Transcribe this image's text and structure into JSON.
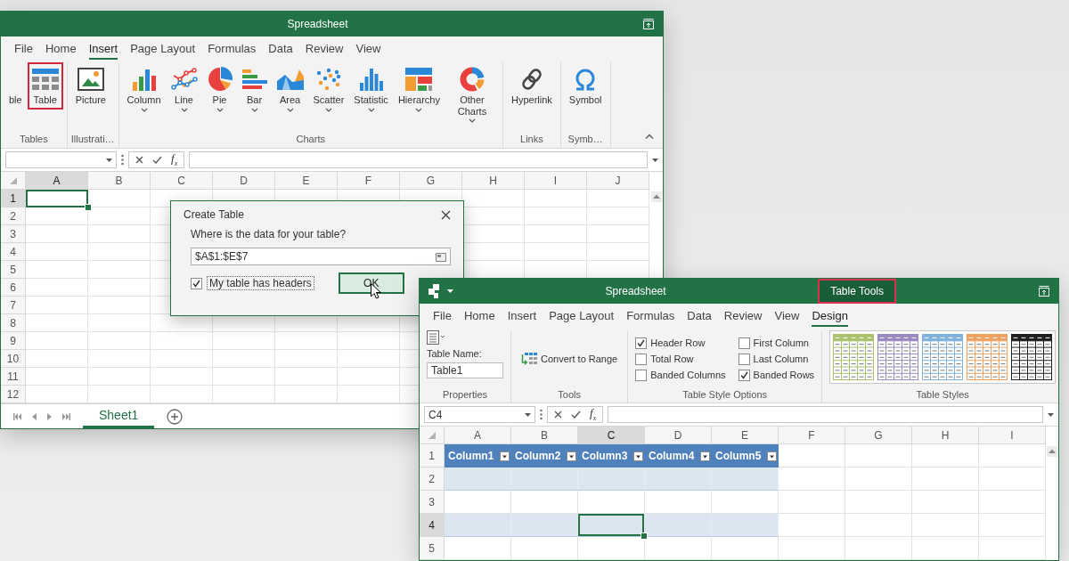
{
  "back_window": {
    "title": "Spreadsheet",
    "tabs": [
      {
        "label": "File",
        "selected": false
      },
      {
        "label": "Home",
        "selected": false
      },
      {
        "label": "Insert",
        "selected": true
      },
      {
        "label": "Page Layout",
        "selected": false
      },
      {
        "label": "Formulas",
        "selected": false
      },
      {
        "label": "Data",
        "selected": false
      },
      {
        "label": "Review",
        "selected": false
      },
      {
        "label": "View",
        "selected": false
      }
    ],
    "ribbon": {
      "groups": [
        {
          "label": "Tables",
          "buttons": [
            {
              "label": "ble",
              "kind": "pivot",
              "dropdown": false,
              "highlighted": false
            },
            {
              "label": "Table",
              "kind": "table",
              "dropdown": false,
              "highlighted": true
            }
          ]
        },
        {
          "label": "Illustrati…",
          "buttons": [
            {
              "label": "Picture",
              "kind": "picture",
              "dropdown": false,
              "highlighted": false
            }
          ]
        },
        {
          "label": "Charts",
          "buttons": [
            {
              "label": "Column",
              "kind": "column",
              "dropdown": true,
              "highlighted": false
            },
            {
              "label": "Line",
              "kind": "line",
              "dropdown": true,
              "highlighted": false
            },
            {
              "label": "Pie",
              "kind": "pie",
              "dropdown": true,
              "highlighted": false
            },
            {
              "label": "Bar",
              "kind": "bar",
              "dropdown": true,
              "highlighted": false
            },
            {
              "label": "Area",
              "kind": "area",
              "dropdown": true,
              "highlighted": false
            },
            {
              "label": "Scatter",
              "kind": "scatter",
              "dropdown": true,
              "highlighted": false
            },
            {
              "label": "Statistic",
              "kind": "statistic",
              "dropdown": true,
              "highlighted": false
            },
            {
              "label": "Hierarchy",
              "kind": "hierarchy",
              "dropdown": true,
              "highlighted": false
            },
            {
              "label": "Other Charts",
              "kind": "other",
              "dropdown": true,
              "highlighted": false
            }
          ]
        },
        {
          "label": "Links",
          "buttons": [
            {
              "label": "Hyperlink",
              "kind": "hyperlink",
              "dropdown": false,
              "highlighted": false
            }
          ]
        },
        {
          "label": "Symb…",
          "buttons": [
            {
              "label": "Symbol",
              "kind": "symbol",
              "dropdown": false,
              "highlighted": false
            }
          ]
        }
      ]
    },
    "function_button": "f$_{x}$",
    "columns": [
      {
        "label": "A",
        "selected": true
      },
      {
        "label": "B",
        "selected": false
      },
      {
        "label": "C",
        "selected": false
      },
      {
        "label": "D",
        "selected": false
      },
      {
        "label": "E",
        "selected": false
      },
      {
        "label": "F",
        "selected": false
      },
      {
        "label": "G",
        "selected": false
      },
      {
        "label": "H",
        "selected": false
      },
      {
        "label": "I",
        "selected": false
      },
      {
        "label": "J",
        "selected": false
      }
    ],
    "rows": [
      {
        "label": "1",
        "selected": true
      },
      {
        "label": "2",
        "selected": false
      },
      {
        "label": "3",
        "selected": false
      },
      {
        "label": "4",
        "selected": false
      },
      {
        "label": "5",
        "selected": false
      },
      {
        "label": "6",
        "selected": false
      },
      {
        "label": "7",
        "selected": false
      },
      {
        "label": "8",
        "selected": false
      },
      {
        "label": "9",
        "selected": false
      },
      {
        "label": "10",
        "selected": false
      },
      {
        "label": "11",
        "selected": false
      },
      {
        "label": "12",
        "selected": false
      }
    ],
    "sheet_tabs": [
      {
        "label": "Sheet1",
        "selected": true
      }
    ]
  },
  "dialog": {
    "title": "Create Table",
    "prompt": "Where is the data for your table?",
    "range": {
      "value": "$A$1:$E$7"
    },
    "headers_checkbox": {
      "label": "My table has headers",
      "checked": true
    },
    "buttons": [
      {
        "label": "OK",
        "focused": true,
        "hovered": true
      }
    ]
  },
  "front_window": {
    "title": "Spreadsheet",
    "context_tab": {
      "label": "Table Tools",
      "highlighted": true
    },
    "tabs": [
      {
        "label": "File",
        "selected": false
      },
      {
        "label": "Home",
        "selected": false
      },
      {
        "label": "Insert",
        "selected": false
      },
      {
        "label": "Page Layout",
        "selected": false
      },
      {
        "label": "Formulas",
        "selected": false
      },
      {
        "label": "Data",
        "selected": false
      },
      {
        "label": "Review",
        "selected": false
      },
      {
        "label": "View",
        "selected": false
      },
      {
        "label": "Design",
        "selected": true
      }
    ],
    "ribbon": {
      "properties": {
        "label": "Properties",
        "name_label": "Table Name:",
        "name_field": {
          "value": "Table1"
        }
      },
      "tools": {
        "label": "Tools",
        "buttons": [
          {
            "label": "Convert to Range"
          }
        ]
      },
      "style_options": {
        "label": "Table Style Options",
        "options": [
          {
            "label": "Header Row",
            "checked": true
          },
          {
            "label": "Total Row",
            "checked": false
          },
          {
            "label": "Banded Columns",
            "checked": false
          },
          {
            "label": "First Column",
            "checked": false
          },
          {
            "label": "Last Column",
            "checked": false
          },
          {
            "label": "Banded Rows",
            "checked": true
          }
        ]
      },
      "table_styles": {
        "label": "Table Styles",
        "styles": [
          {
            "color": "#a9c26b"
          },
          {
            "color": "#9a88c0"
          },
          {
            "color": "#7fb2de"
          },
          {
            "color": "#f0a160"
          },
          {
            "color": "#1f1f1f"
          }
        ]
      }
    },
    "name_box": {
      "value": "C4"
    },
    "function_button": "f$_{x}$",
    "columns": [
      {
        "label": "A",
        "selected": false
      },
      {
        "label": "B",
        "selected": false
      },
      {
        "label": "C",
        "selected": true
      },
      {
        "label": "D",
        "selected": false
      },
      {
        "label": "E",
        "selected": false
      },
      {
        "label": "F",
        "selected": false
      },
      {
        "label": "G",
        "selected": false
      },
      {
        "label": "H",
        "selected": false
      },
      {
        "label": "I",
        "selected": false
      }
    ],
    "rows": [
      {
        "label": "1",
        "selected": false
      },
      {
        "label": "2",
        "selected": false
      },
      {
        "label": "3",
        "selected": false
      },
      {
        "label": "4",
        "selected": true
      },
      {
        "label": "5",
        "selected": false
      }
    ],
    "table": {
      "header": [
        {
          "label": "Column1"
        },
        {
          "label": "Column2"
        },
        {
          "label": "Column3"
        },
        {
          "label": "Column4"
        },
        {
          "label": "Column5"
        }
      ],
      "banded": true
    }
  }
}
